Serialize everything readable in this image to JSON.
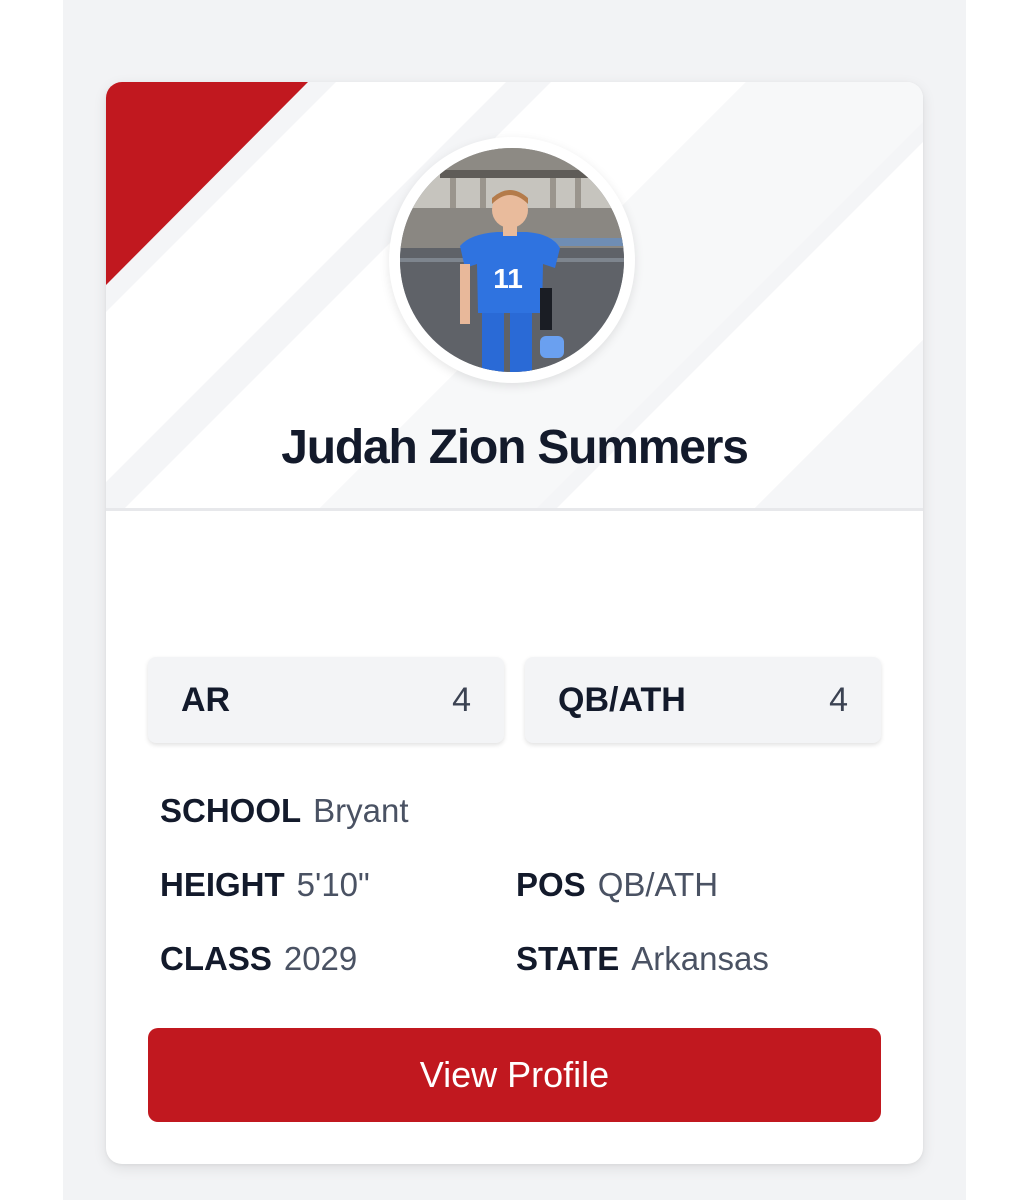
{
  "player": {
    "name": "Judah Zion Summers",
    "jersey_number": "11"
  },
  "rankings": [
    {
      "label": "AR",
      "value": "4"
    },
    {
      "label": "QB/ATH",
      "value": "4"
    }
  ],
  "info": {
    "school": {
      "label": "SCHOOL",
      "value": "Bryant"
    },
    "height": {
      "label": "HEIGHT",
      "value": "5'10\""
    },
    "pos": {
      "label": "POS",
      "value": "QB/ATH"
    },
    "class": {
      "label": "CLASS",
      "value": "2029"
    },
    "state": {
      "label": "STATE",
      "value": "Arkansas"
    }
  },
  "cta": {
    "label": "View Profile"
  },
  "colors": {
    "accent": "#c1181f",
    "text": "#131a2b",
    "muted": "#4a5263",
    "background": "#f2f3f5"
  }
}
